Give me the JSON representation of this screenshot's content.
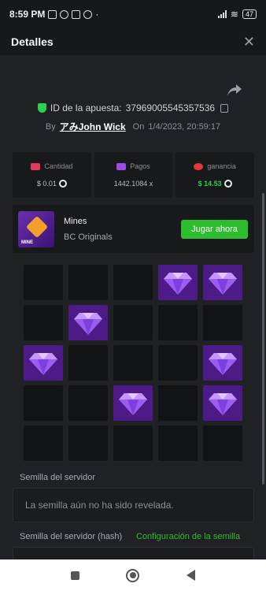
{
  "status_bar": {
    "time": "8:59 PM",
    "battery": "47"
  },
  "header": {
    "title": "Detalles"
  },
  "bet": {
    "id_label": "ID de la apuesta:",
    "id_value": "37969005545357536",
    "by_label": "By",
    "user": "アみJohn Wick",
    "on_label": "On",
    "date": "1/4/2023, 20:59:17"
  },
  "stats": {
    "amount": {
      "label": "Cantidad",
      "value": "$ 0.01"
    },
    "payout": {
      "label": "Pagos",
      "value": "1442.1084 x"
    },
    "profit": {
      "label": "ganancia",
      "value": "$ 14.53"
    }
  },
  "game": {
    "name": "Mines",
    "provider": "BC Originals",
    "thumb_label": "MINE",
    "play_button": "Jugar ahora"
  },
  "board": {
    "rows": 5,
    "cols": 5,
    "gem_tiles": [
      [
        0,
        0,
        0,
        1,
        1
      ],
      [
        0,
        1,
        0,
        0,
        0
      ],
      [
        1,
        0,
        0,
        0,
        1
      ],
      [
        0,
        0,
        1,
        0,
        1
      ],
      [
        0,
        0,
        0,
        0,
        0
      ]
    ]
  },
  "seeds": {
    "server_seed_label": "Semilla del servidor",
    "server_seed_value": "La semilla aún no ha sido revelada.",
    "server_hash_label": "Semilla del servidor (hash)",
    "config_link": "Configuración de la semilla"
  },
  "colors": {
    "accent_green": "#2fbd30",
    "gem_bg": "#4d1b87",
    "profit_green": "#2bd14a"
  },
  "icons": [
    "verified-shield-icon",
    "copy-icon",
    "share-icon",
    "close-icon",
    "amount-icon",
    "payout-icon",
    "profit-icon",
    "coin-icon",
    "diamond-icon"
  ]
}
